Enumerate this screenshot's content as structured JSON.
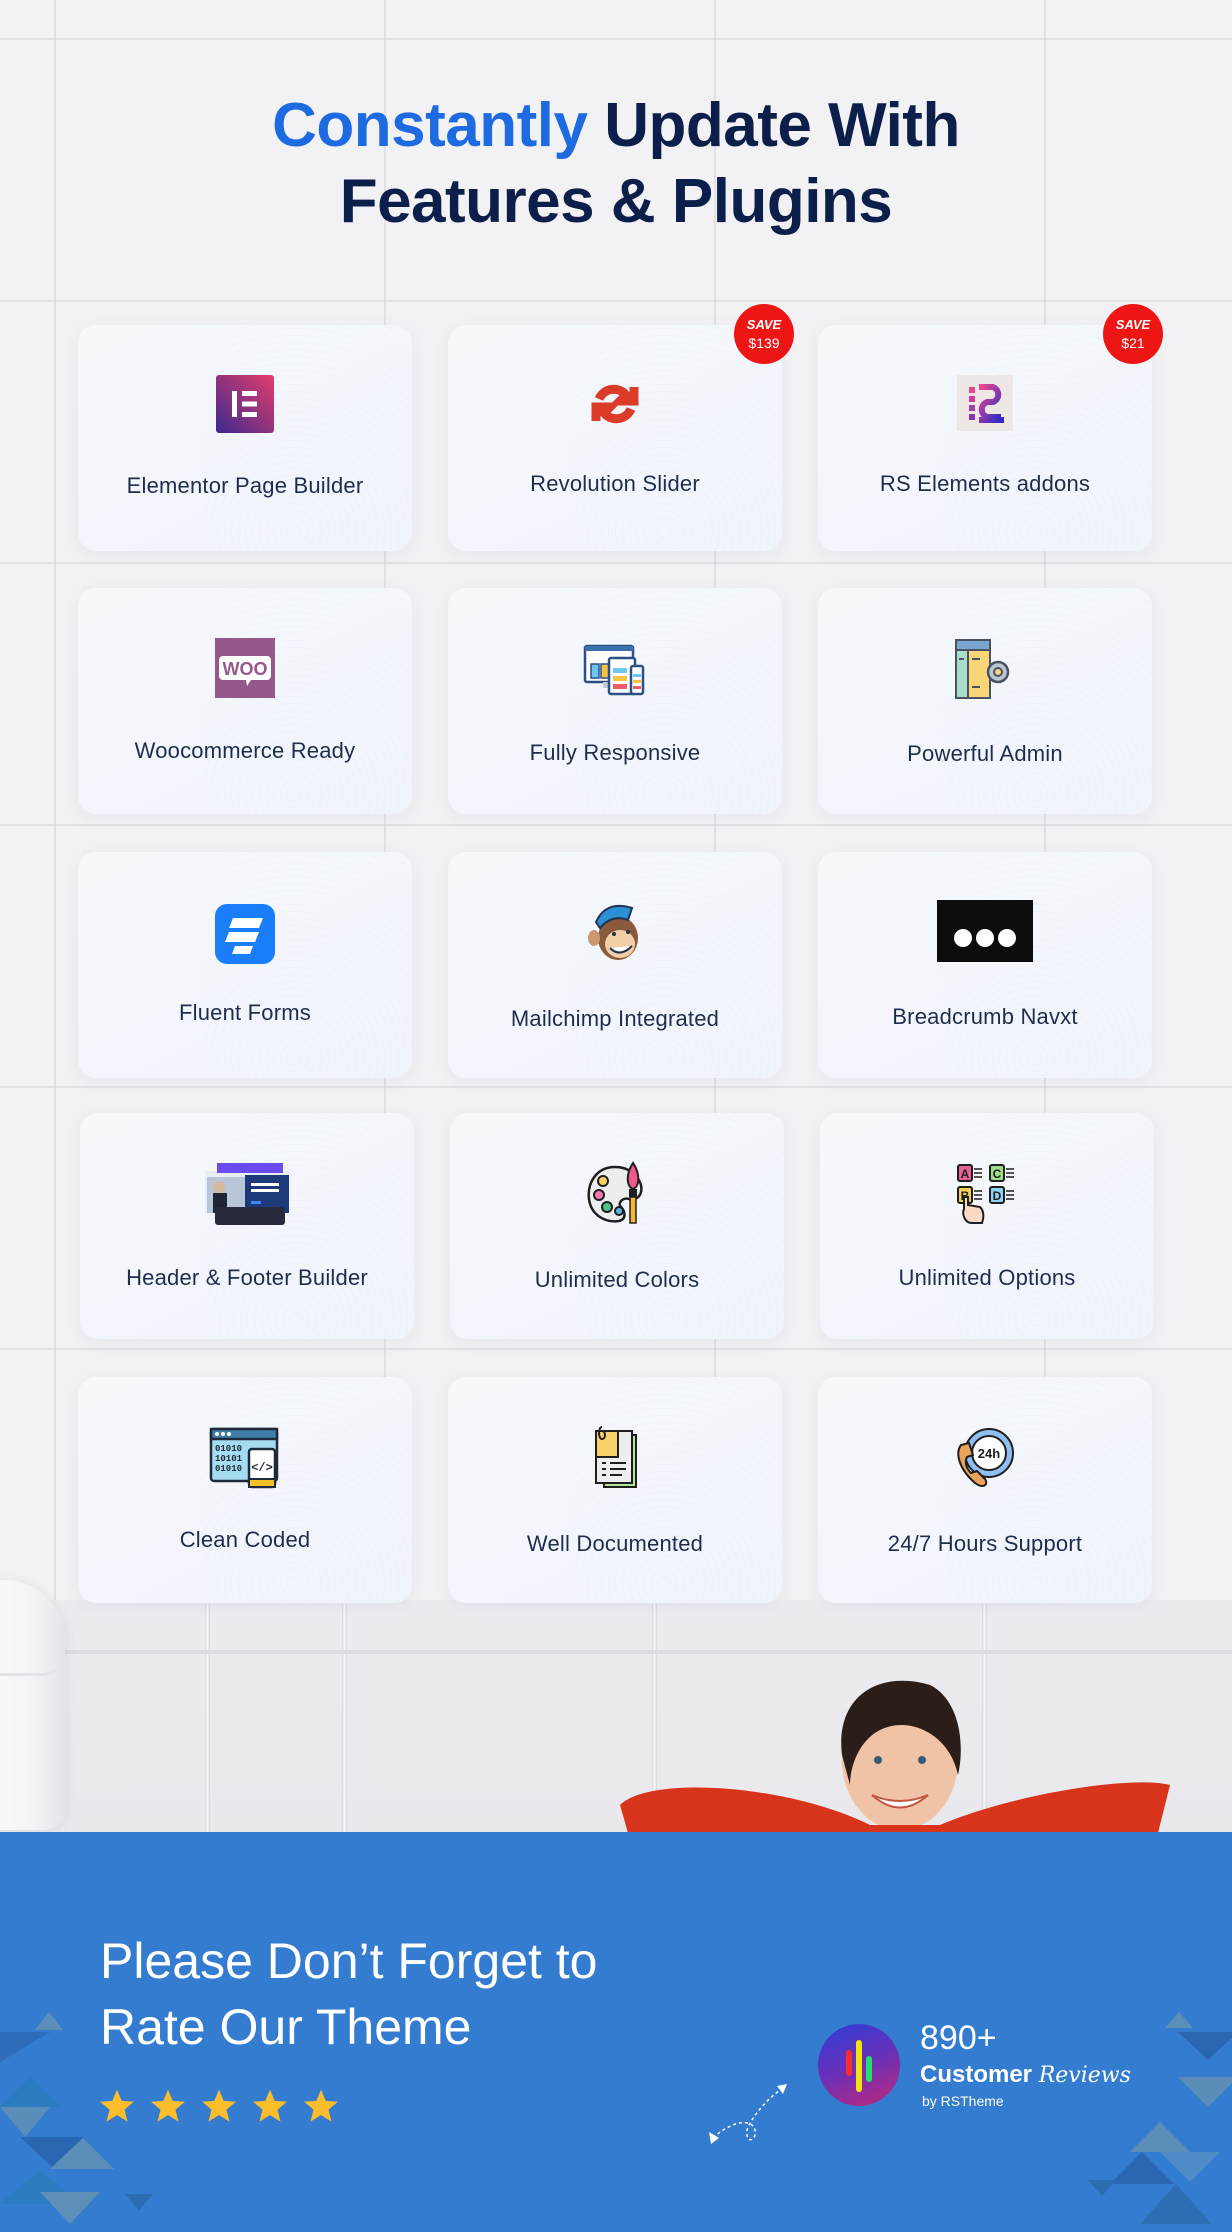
{
  "header": {
    "title_accent": "Constantly",
    "title_rest_line1": "Update With",
    "title_line2": "Features & Plugins"
  },
  "colors": {
    "accent": "#1e6ae1",
    "heading": "#0c1f4a",
    "card_text": "#1f2d4d",
    "badge": "#ee1515",
    "banner": "#347ccf",
    "star": "#fbbd2a"
  },
  "features": [
    {
      "label": "Elementor Page Builder",
      "icon": "elementor-icon"
    },
    {
      "label": "Revolution Slider",
      "icon": "revolution-slider-icon",
      "badge": {
        "line1": "SAVE",
        "line2": "$139"
      }
    },
    {
      "label": "RS Elements addons",
      "icon": "rs-elements-icon",
      "badge": {
        "line1": "SAVE",
        "line2": "$21"
      }
    },
    {
      "label": "Woocommerce Ready",
      "icon": "woocommerce-icon"
    },
    {
      "label": "Fully Responsive",
      "icon": "responsive-devices-icon"
    },
    {
      "label": "Powerful Admin",
      "icon": "admin-settings-icon"
    },
    {
      "label": "Fluent Forms",
      "icon": "fluent-forms-icon"
    },
    {
      "label": "Mailchimp Integrated",
      "icon": "mailchimp-icon"
    },
    {
      "label": "Breadcrumb Navxt",
      "icon": "breadcrumb-icon"
    },
    {
      "label": "Header & Footer Builder",
      "icon": "header-footer-preview-icon"
    },
    {
      "label": "Unlimited Colors",
      "icon": "palette-icon"
    },
    {
      "label": "Unlimited Options",
      "icon": "options-abcd-icon"
    },
    {
      "label": "Clean Coded",
      "icon": "code-window-icon"
    },
    {
      "label": "Well Documented",
      "icon": "documents-icon"
    },
    {
      "label": "24/7 Hours Support",
      "icon": "support-24h-icon"
    }
  ],
  "banner": {
    "title_line1": "Please Don’t Forget to",
    "title_line2": "Rate Our Theme",
    "rating": 5,
    "rating_max": 5,
    "reviews_count": "890+",
    "reviews_label": "Customer",
    "reviews_label_script": "Reviews",
    "reviews_by": "by RSTheme"
  }
}
